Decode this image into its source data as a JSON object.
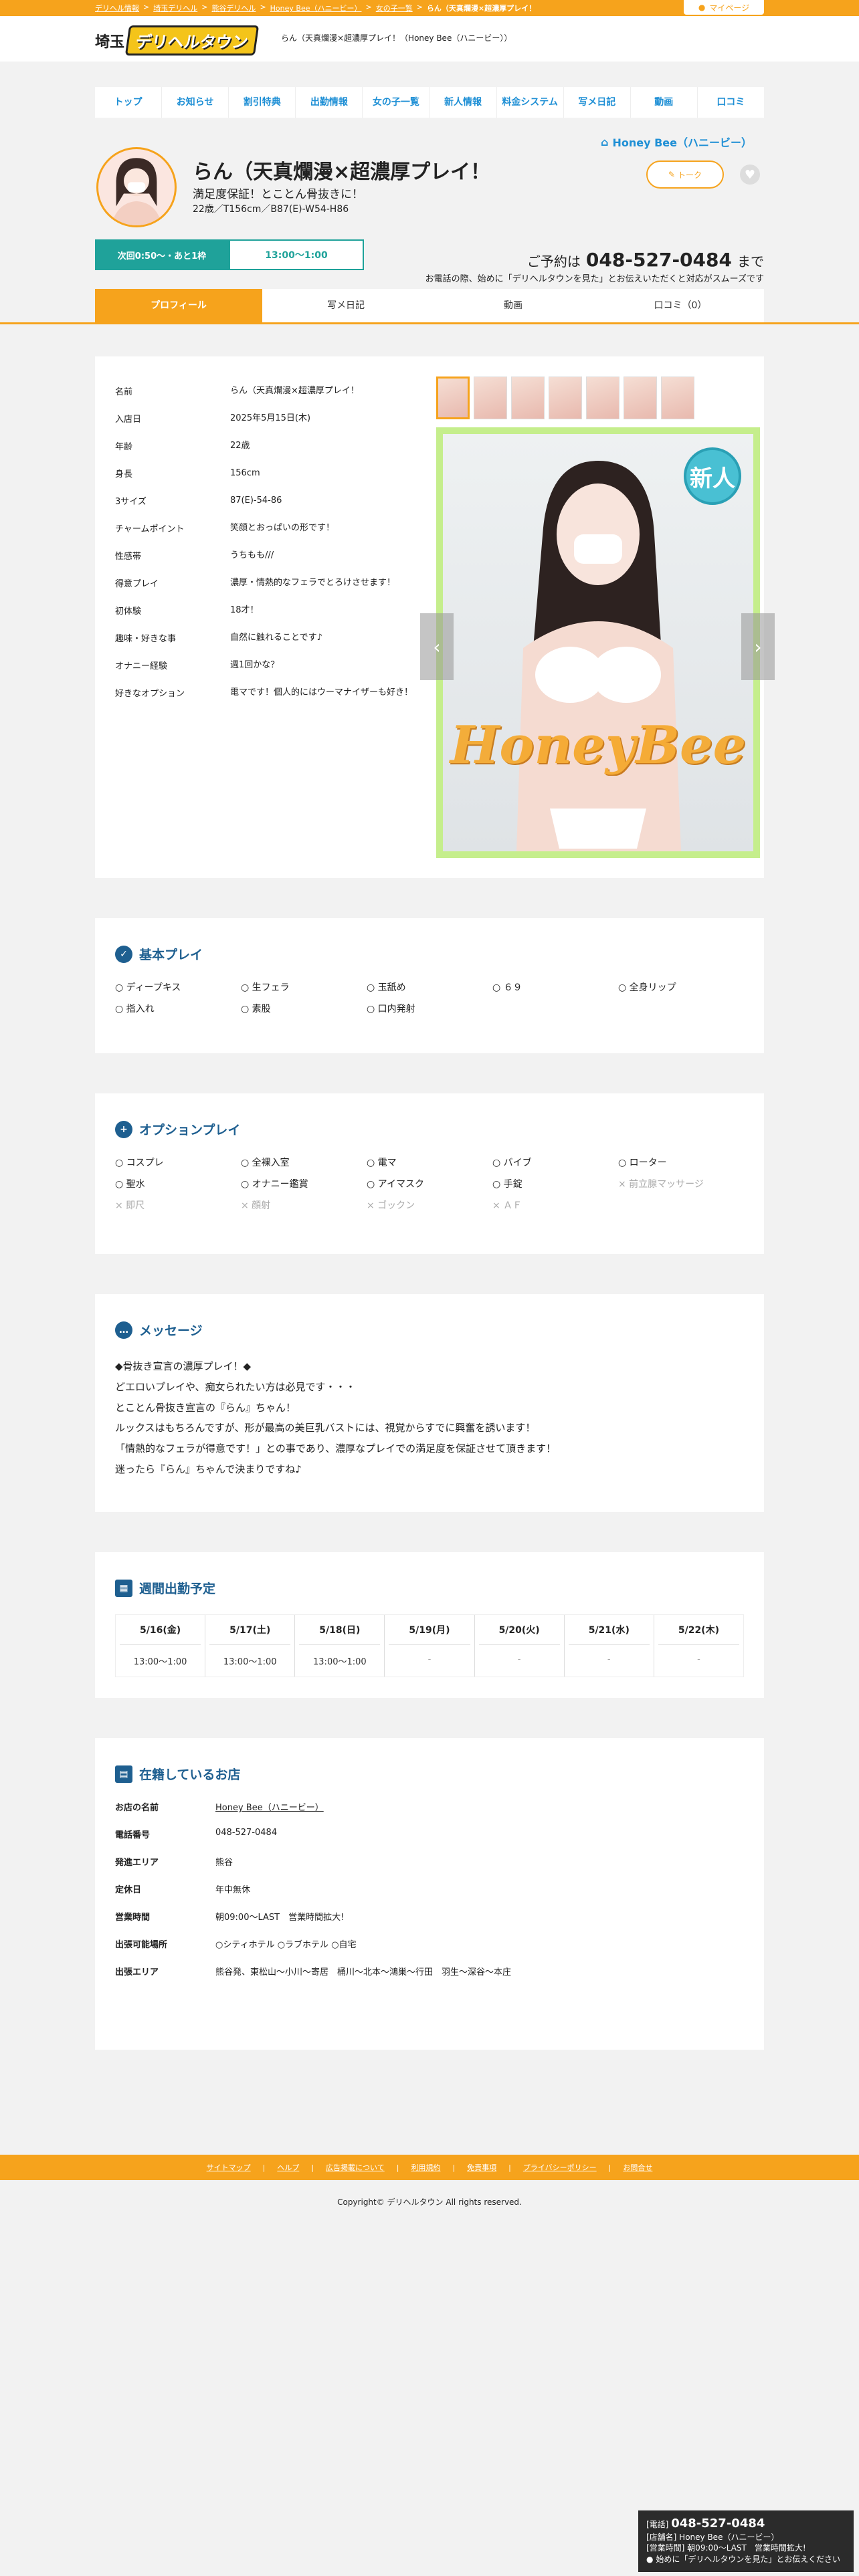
{
  "breadcrumb": [
    "デリヘル情報",
    "埼玉デリヘル",
    "熊谷デリヘル",
    "Honey Bee（ハニービー）",
    "女の子一覧",
    "らん（天真爛漫×超濃厚プレイ！"
  ],
  "mypage": "マイページ",
  "logo": {
    "prefix": "埼玉",
    "main": "デリヘルタウン"
  },
  "header_text": "らん（天真爛漫×超濃厚プレイ！（Honey Bee（ハニービー））",
  "nav": [
    "トップ",
    "お知らせ",
    "割引特典",
    "出勤情報",
    "女の子一覧",
    "新人情報",
    "料金システム",
    "写メ日記",
    "動画",
    "口コミ"
  ],
  "shop_name": "Honey Bee（ハニービー）",
  "profile": {
    "name": "らん（天真爛漫×超濃厚プレイ！",
    "catch": "満足度保証！とことん骨抜きに！",
    "specs": "22歳／T156cm／B87(E)-W54-H86",
    "next_badge": "次回0:50〜・あと1枠",
    "next_time": "13:00〜1:00",
    "talk": "トーク",
    "reserve_pre": "ご予約は",
    "tel": "048-527-0484",
    "reserve_post": "まで",
    "notice": "お電話の際、始めに「デリヘルタウンを見た」とお伝えいただくと対応がスムーズです"
  },
  "tabs": [
    "プロフィール",
    "写メ日記",
    "動画",
    "口コミ（0）"
  ],
  "details": [
    {
      "k": "名前",
      "v": "らん（天真爛漫×超濃厚プレイ！"
    },
    {
      "k": "入店日",
      "v": "2025年5月15日(木)"
    },
    {
      "k": "年齢",
      "v": "22歳"
    },
    {
      "k": "身長",
      "v": "156cm"
    },
    {
      "k": "3サイズ",
      "v": "87(E)-54-86"
    },
    {
      "k": "チャームポイント",
      "v": "笑顔とおっぱいの形です！"
    },
    {
      "k": "性感帯",
      "v": "うちもも///"
    },
    {
      "k": "得意プレイ",
      "v": "濃厚・情熱的なフェラでとろけさせます！"
    },
    {
      "k": "初体験",
      "v": "18才！"
    },
    {
      "k": "趣味・好きな事",
      "v": "自然に触れることです♪"
    },
    {
      "k": "オナニー経験",
      "v": "週1回かな？"
    },
    {
      "k": "好きなオプション",
      "v": "電マです！個人的にはウーマナイザーも好き！"
    }
  ],
  "photo": {
    "new_badge": "新人",
    "watermark": "HoneyBee"
  },
  "basic": {
    "title": "基本プレイ",
    "items": [
      "○ ディープキス",
      "○ 生フェラ",
      "○ 玉舐め",
      "○ ６９",
      "○ 全身リップ",
      "○ 指入れ",
      "○ 素股",
      "○ 口内発射"
    ]
  },
  "option": {
    "title": "オプションプレイ",
    "items": [
      {
        "t": "○ コスプレ",
        "ok": true
      },
      {
        "t": "○ 全裸入室",
        "ok": true
      },
      {
        "t": "○ 電マ",
        "ok": true
      },
      {
        "t": "○ バイブ",
        "ok": true
      },
      {
        "t": "○ ローター",
        "ok": true
      },
      {
        "t": "○ 聖水",
        "ok": true
      },
      {
        "t": "○ オナニー鑑賞",
        "ok": true
      },
      {
        "t": "○ アイマスク",
        "ok": true
      },
      {
        "t": "○ 手錠",
        "ok": true
      },
      {
        "t": "× 前立腺マッサージ",
        "ok": false
      },
      {
        "t": "× 即尺",
        "ok": false
      },
      {
        "t": "× 顔射",
        "ok": false
      },
      {
        "t": "× ゴックン",
        "ok": false
      },
      {
        "t": "× ＡＦ",
        "ok": false
      }
    ]
  },
  "message": {
    "title": "メッセージ",
    "lines": [
      "◆骨抜き宣言の濃厚プレイ！◆",
      "どエロいプレイや、痴女られたい方は必見です・・・",
      "とことん骨抜き宣言の『らん』ちゃん！",
      "ルックスはもちろんですが、形が最高の美巨乳バストには、視覚からすでに興奮を誘います！",
      "「情熱的なフェラが得意です！」との事であり、濃厚なプレイでの満足度を保証させて頂きます！",
      "迷ったら『らん』ちゃんで決まりですね♪"
    ]
  },
  "schedule": {
    "title": "週間出勤予定",
    "days": [
      {
        "d": "5/16(金)",
        "t": "13:00〜1:00"
      },
      {
        "d": "5/17(土)",
        "t": "13:00〜1:00"
      },
      {
        "d": "5/18(日)",
        "t": "13:00〜1:00"
      },
      {
        "d": "5/19(月)",
        "t": "-"
      },
      {
        "d": "5/20(火)",
        "t": "-"
      },
      {
        "d": "5/21(水)",
        "t": "-"
      },
      {
        "d": "5/22(木)",
        "t": "-"
      }
    ]
  },
  "shop": {
    "title": "在籍しているお店",
    "rows": [
      {
        "k": "お店の名前",
        "v": "Honey Bee（ハニービー）",
        "link": true
      },
      {
        "k": "電話番号",
        "v": "048-527-0484"
      },
      {
        "k": "発進エリア",
        "v": "熊谷"
      },
      {
        "k": "定休日",
        "v": "年中無休"
      },
      {
        "k": "営業時間",
        "v": "朝09:00〜LAST　営業時間拡大!"
      },
      {
        "k": "出張可能場所",
        "v": "○シティホテル ○ラブホテル ○自宅"
      },
      {
        "k": "出張エリア",
        "v": "熊谷発、東松山〜小川〜寄居　桶川〜北本〜鴻巣〜行田　羽生〜深谷〜本庄"
      }
    ]
  },
  "footer": [
    "サイトマップ",
    "ヘルプ",
    "広告掲載について",
    "利用規約",
    "免責事項",
    "プライバシーポリシー",
    "お問合せ"
  ],
  "copyright": "Copyright© デリヘルタウン All rights reserved.",
  "floatbox": {
    "tel_label": "[電話]",
    "tel": "048-527-0484",
    "shop": "[店舗名] Honey Bee（ハニービー）",
    "hours": "[営業時間] 朝09:00〜LAST　営業時間拡大!",
    "note": "始めに「デリヘルタウンを見た」とお伝えください"
  }
}
